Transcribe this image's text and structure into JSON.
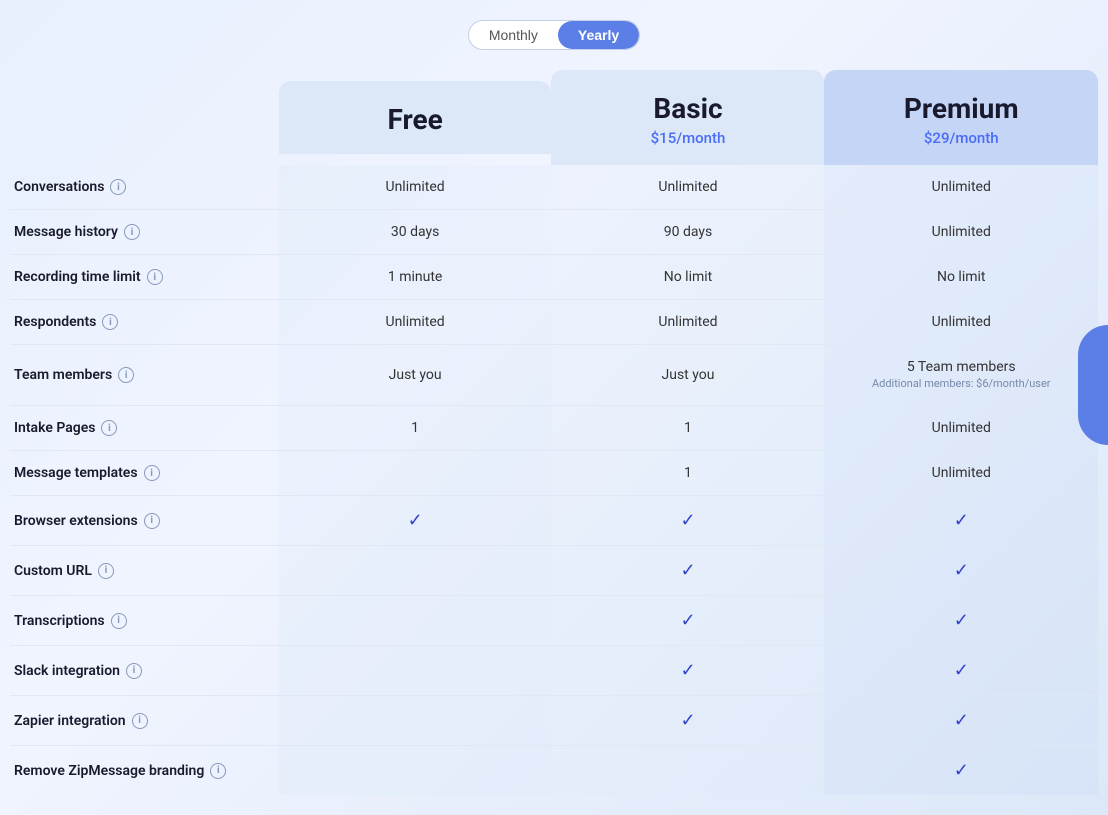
{
  "billing": {
    "toggle": {
      "monthly_label": "Monthly",
      "yearly_label": "Yearly",
      "active": "yearly"
    }
  },
  "plans": {
    "free": {
      "name": "Free",
      "price": ""
    },
    "basic": {
      "name": "Basic",
      "price": "$15/month"
    },
    "premium": {
      "name": "Premium",
      "price": "$29/month"
    }
  },
  "features": [
    {
      "label": "Conversations",
      "free": "Unlimited",
      "basic": "Unlimited",
      "premium": "Unlimited",
      "free_type": "text",
      "basic_type": "text",
      "premium_type": "text"
    },
    {
      "label": "Message history",
      "free": "30 days",
      "basic": "90 days",
      "premium": "Unlimited",
      "free_type": "text",
      "basic_type": "text",
      "premium_type": "text"
    },
    {
      "label": "Recording time limit",
      "free": "1 minute",
      "basic": "No limit",
      "premium": "No limit",
      "free_type": "text",
      "basic_type": "text",
      "premium_type": "text"
    },
    {
      "label": "Respondents",
      "free": "Unlimited",
      "basic": "Unlimited",
      "premium": "Unlimited",
      "free_type": "text",
      "basic_type": "text",
      "premium_type": "text"
    },
    {
      "label": "Team members",
      "free": "Just you",
      "basic": "Just you",
      "premium": "5 Team members",
      "premium_note": "Additional members: $6/month/user",
      "free_type": "text",
      "basic_type": "text",
      "premium_type": "text_note"
    },
    {
      "label": "Intake Pages",
      "free": "1",
      "basic": "1",
      "premium": "Unlimited",
      "free_type": "text",
      "basic_type": "text",
      "premium_type": "text"
    },
    {
      "label": "Message templates",
      "free": "",
      "basic": "1",
      "premium": "Unlimited",
      "free_type": "empty",
      "basic_type": "text",
      "premium_type": "text"
    },
    {
      "label": "Browser extensions",
      "free": "✓",
      "basic": "✓",
      "premium": "✓",
      "free_type": "check",
      "basic_type": "check",
      "premium_type": "check"
    },
    {
      "label": "Custom URL",
      "free": "",
      "basic": "✓",
      "premium": "✓",
      "free_type": "empty",
      "basic_type": "check",
      "premium_type": "check"
    },
    {
      "label": "Transcriptions",
      "free": "",
      "basic": "✓",
      "premium": "✓",
      "free_type": "empty",
      "basic_type": "check",
      "premium_type": "check"
    },
    {
      "label": "Slack integration",
      "free": "",
      "basic": "✓",
      "premium": "✓",
      "free_type": "empty",
      "basic_type": "check",
      "premium_type": "check"
    },
    {
      "label": "Zapier integration",
      "free": "",
      "basic": "✓",
      "premium": "✓",
      "free_type": "empty",
      "basic_type": "check",
      "premium_type": "check"
    },
    {
      "label": "Remove ZipMessage branding",
      "free": "",
      "basic": "",
      "premium": "✓",
      "free_type": "empty",
      "basic_type": "empty",
      "premium_type": "check"
    }
  ]
}
